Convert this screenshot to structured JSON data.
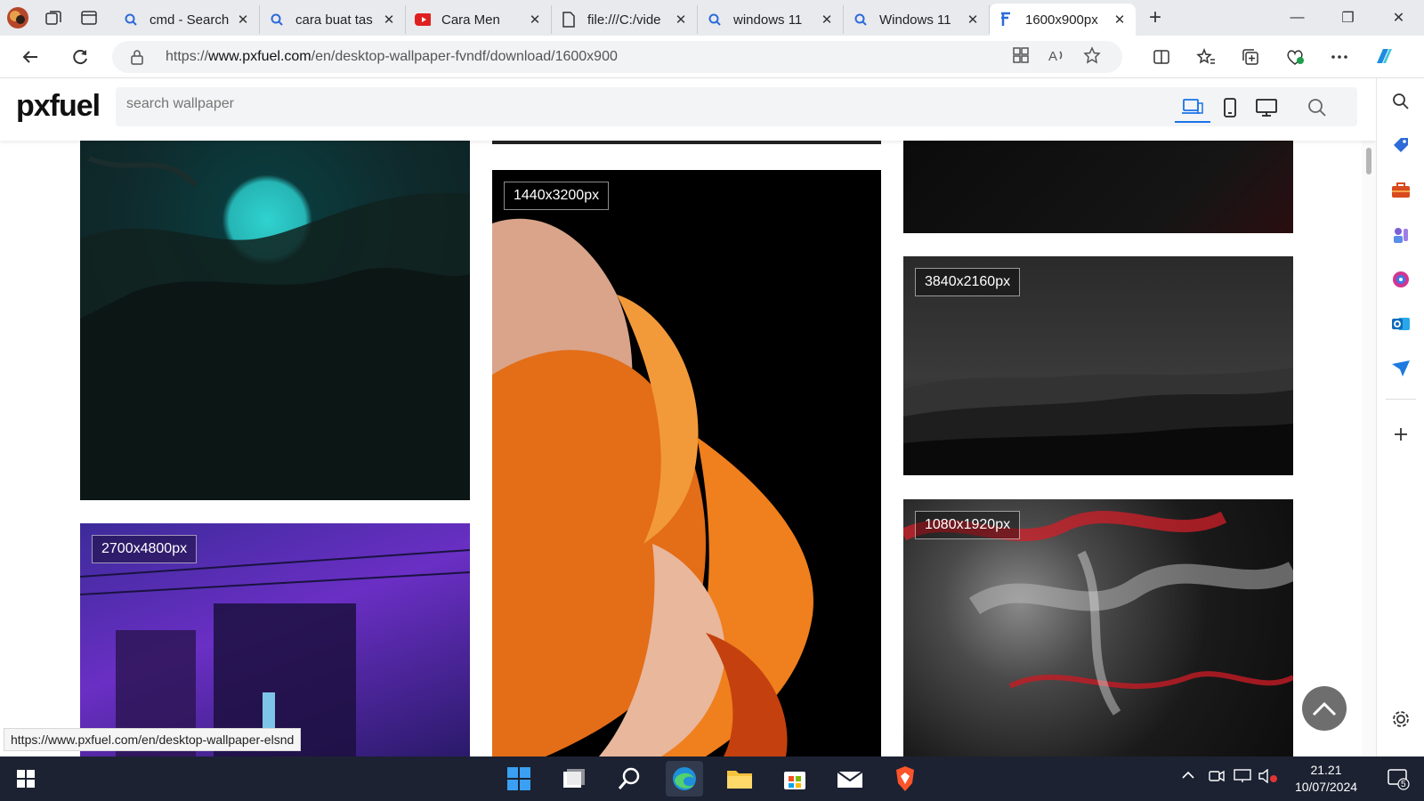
{
  "tabs": [
    {
      "title": "cmd - Search",
      "icon": "search-icon"
    },
    {
      "title": "cara buat tas",
      "icon": "search-icon"
    },
    {
      "title": "Cara Men",
      "icon": "youtube-icon"
    },
    {
      "title": "file:///C:/vide",
      "icon": "file-icon"
    },
    {
      "title": "windows 11",
      "icon": "search-icon"
    },
    {
      "title": "Windows 11",
      "icon": "search-icon"
    },
    {
      "title": "1600x900px",
      "icon": "pxfuel-icon",
      "active": true
    }
  ],
  "address": {
    "prefix": "https://",
    "domain": "www.pxfuel.com",
    "path": "/en/desktop-wallpaper-fvndf/download/1600x900"
  },
  "site": {
    "logo": "pxfuel",
    "search_placeholder": "search wallpaper"
  },
  "tiles": [
    {
      "badge": "1440x3200px"
    },
    {
      "badge": "3840x2160px"
    },
    {
      "badge": "2700x4800px"
    },
    {
      "badge": "1080x1920px"
    }
  ],
  "status_url": "https://www.pxfuel.com/en/desktop-wallpaper-elsnd",
  "clock": {
    "time": "21.21",
    "date": "10/07/2024"
  },
  "notifications": "5",
  "colors": {
    "accent": "#1a73e8",
    "taskbar": "#1c2232"
  }
}
